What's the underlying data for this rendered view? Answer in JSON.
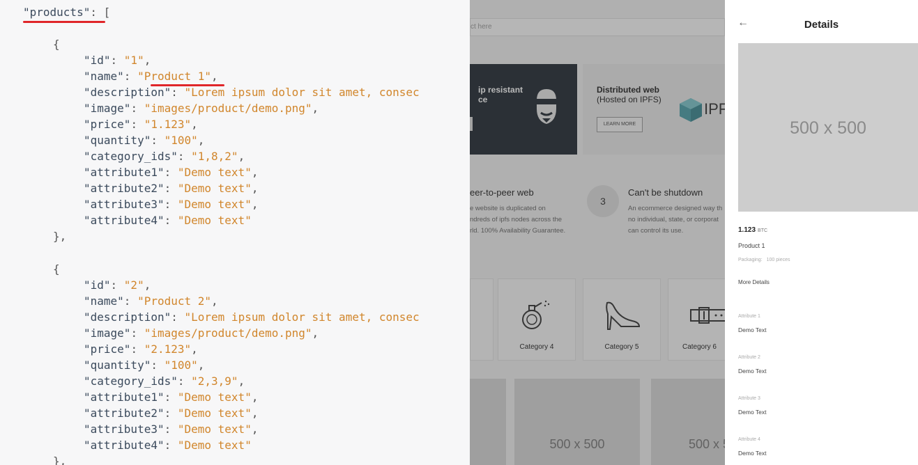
{
  "code": {
    "lines": [
      {
        "parts": [
          {
            "c": "k",
            "t": "\"products\""
          },
          {
            "c": "p",
            "t": ": ["
          }
        ]
      },
      {
        "parts": [
          {
            "c": "p",
            "t": "{"
          }
        ]
      },
      {
        "parts": [
          {
            "c": "k",
            "t": "\"id\""
          },
          {
            "c": "p",
            "t": ": "
          },
          {
            "c": "v",
            "t": "\"1\""
          },
          {
            "c": "p",
            "t": ","
          }
        ]
      },
      {
        "parts": [
          {
            "c": "k",
            "t": "\"name\""
          },
          {
            "c": "p",
            "t": ": "
          },
          {
            "c": "v",
            "t": "\"Product 1\""
          },
          {
            "c": "p",
            "t": ","
          }
        ]
      },
      {
        "parts": [
          {
            "c": "k",
            "t": "\"description\""
          },
          {
            "c": "p",
            "t": ": "
          },
          {
            "c": "v",
            "t": "\"Lorem ipsum dolor sit amet, consec"
          }
        ]
      },
      {
        "parts": [
          {
            "c": "k",
            "t": "\"image\""
          },
          {
            "c": "p",
            "t": ": "
          },
          {
            "c": "v",
            "t": "\"images/product/demo.png\""
          },
          {
            "c": "p",
            "t": ","
          }
        ]
      },
      {
        "parts": [
          {
            "c": "k",
            "t": "\"price\""
          },
          {
            "c": "p",
            "t": ": "
          },
          {
            "c": "v",
            "t": "\"1.123\""
          },
          {
            "c": "p",
            "t": ","
          }
        ]
      },
      {
        "parts": [
          {
            "c": "k",
            "t": "\"quantity\""
          },
          {
            "c": "p",
            "t": ": "
          },
          {
            "c": "v",
            "t": "\"100\""
          },
          {
            "c": "p",
            "t": ","
          }
        ]
      },
      {
        "parts": [
          {
            "c": "k",
            "t": "\"category_ids\""
          },
          {
            "c": "p",
            "t": ": "
          },
          {
            "c": "v",
            "t": "\"1,8,2\""
          },
          {
            "c": "p",
            "t": ","
          }
        ]
      },
      {
        "parts": [
          {
            "c": "k",
            "t": "\"attribute1\""
          },
          {
            "c": "p",
            "t": ": "
          },
          {
            "c": "v",
            "t": "\"Demo text\""
          },
          {
            "c": "p",
            "t": ","
          }
        ]
      },
      {
        "parts": [
          {
            "c": "k",
            "t": "\"attribute2\""
          },
          {
            "c": "p",
            "t": ": "
          },
          {
            "c": "v",
            "t": "\"Demo text\""
          },
          {
            "c": "p",
            "t": ","
          }
        ]
      },
      {
        "parts": [
          {
            "c": "k",
            "t": "\"attribute3\""
          },
          {
            "c": "p",
            "t": ": "
          },
          {
            "c": "v",
            "t": "\"Demo text\""
          },
          {
            "c": "p",
            "t": ","
          }
        ]
      },
      {
        "parts": [
          {
            "c": "k",
            "t": "\"attribute4\""
          },
          {
            "c": "p",
            "t": ": "
          },
          {
            "c": "v",
            "t": "\"Demo text\""
          }
        ]
      },
      {
        "parts": [
          {
            "c": "p",
            "t": "},"
          }
        ]
      },
      {
        "parts": [
          {
            "c": "p",
            "t": "{"
          }
        ]
      },
      {
        "parts": [
          {
            "c": "k",
            "t": "\"id\""
          },
          {
            "c": "p",
            "t": ": "
          },
          {
            "c": "v",
            "t": "\"2\""
          },
          {
            "c": "p",
            "t": ","
          }
        ]
      },
      {
        "parts": [
          {
            "c": "k",
            "t": "\"name\""
          },
          {
            "c": "p",
            "t": ": "
          },
          {
            "c": "v",
            "t": "\"Product 2\""
          },
          {
            "c": "p",
            "t": ","
          }
        ]
      },
      {
        "parts": [
          {
            "c": "k",
            "t": "\"description\""
          },
          {
            "c": "p",
            "t": ": "
          },
          {
            "c": "v",
            "t": "\"Lorem ipsum dolor sit amet, consec"
          }
        ]
      },
      {
        "parts": [
          {
            "c": "k",
            "t": "\"image\""
          },
          {
            "c": "p",
            "t": ": "
          },
          {
            "c": "v",
            "t": "\"images/product/demo.png\""
          },
          {
            "c": "p",
            "t": ","
          }
        ]
      },
      {
        "parts": [
          {
            "c": "k",
            "t": "\"price\""
          },
          {
            "c": "p",
            "t": ": "
          },
          {
            "c": "v",
            "t": "\"2.123\""
          },
          {
            "c": "p",
            "t": ","
          }
        ]
      },
      {
        "parts": [
          {
            "c": "k",
            "t": "\"quantity\""
          },
          {
            "c": "p",
            "t": ": "
          },
          {
            "c": "v",
            "t": "\"100\""
          },
          {
            "c": "p",
            "t": ","
          }
        ]
      },
      {
        "parts": [
          {
            "c": "k",
            "t": "\"category_ids\""
          },
          {
            "c": "p",
            "t": ": "
          },
          {
            "c": "v",
            "t": "\"2,3,9\""
          },
          {
            "c": "p",
            "t": ","
          }
        ]
      },
      {
        "parts": [
          {
            "c": "k",
            "t": "\"attribute1\""
          },
          {
            "c": "p",
            "t": ": "
          },
          {
            "c": "v",
            "t": "\"Demo text\""
          },
          {
            "c": "p",
            "t": ","
          }
        ]
      },
      {
        "parts": [
          {
            "c": "k",
            "t": "\"attribute2\""
          },
          {
            "c": "p",
            "t": ": "
          },
          {
            "c": "v",
            "t": "\"Demo text\""
          },
          {
            "c": "p",
            "t": ","
          }
        ]
      },
      {
        "parts": [
          {
            "c": "k",
            "t": "\"attribute3\""
          },
          {
            "c": "p",
            "t": ": "
          },
          {
            "c": "v",
            "t": "\"Demo text\""
          },
          {
            "c": "p",
            "t": ","
          }
        ]
      },
      {
        "parts": [
          {
            "c": "k",
            "t": "\"attribute4\""
          },
          {
            "c": "p",
            "t": ": "
          },
          {
            "c": "v",
            "t": "\"Demo text\""
          }
        ]
      },
      {
        "parts": [
          {
            "c": "p",
            "t": "},"
          }
        ]
      }
    ],
    "colors": {
      "key": "#3b4a5c",
      "value": "#d1862c",
      "underline": "#e0262a"
    }
  },
  "store": {
    "search_placeholder": "ct here",
    "banner_dark": {
      "title": "ip resistant\nce"
    },
    "banner_light": {
      "title": "Distributed web",
      "subtitle": "(Hosted on IPFS)",
      "brand": "IPF",
      "button": "LEARN MORE"
    },
    "features": [
      {
        "title": "eer-to-peer web",
        "desc": "e website is duplicated on\nndreds of ipfs nodes across the\nrld. 100% Availability Guarantee."
      },
      {
        "number": "3",
        "title": "Can't be shutdown",
        "desc": "An ecommerce designed way th\nno individual, state, or corporat\ncan control its use."
      }
    ],
    "categories": [
      {
        "label": "Category 4",
        "icon": "perfume-icon"
      },
      {
        "label": "Category 5",
        "icon": "high-heel-icon"
      },
      {
        "label": "Category 6",
        "icon": "belt-icon"
      }
    ],
    "products": [
      {
        "placeholder": "500 x 500"
      },
      {
        "placeholder": "500 x 5"
      }
    ]
  },
  "details": {
    "title": "Details",
    "image_placeholder": "500 x 500",
    "price": "1.123",
    "currency": "BTC",
    "name": "Product 1",
    "packaging_label": "Packaging:",
    "packaging_value": "100 pieces",
    "more_details": "More Details",
    "attributes": [
      {
        "label": "Attribute 1",
        "value": "Demo Text"
      },
      {
        "label": "Attribute 2",
        "value": "Demo Text"
      },
      {
        "label": "Attribute 3",
        "value": "Demo Text"
      },
      {
        "label": "Attribute 4",
        "value": "Demo Text"
      }
    ]
  }
}
